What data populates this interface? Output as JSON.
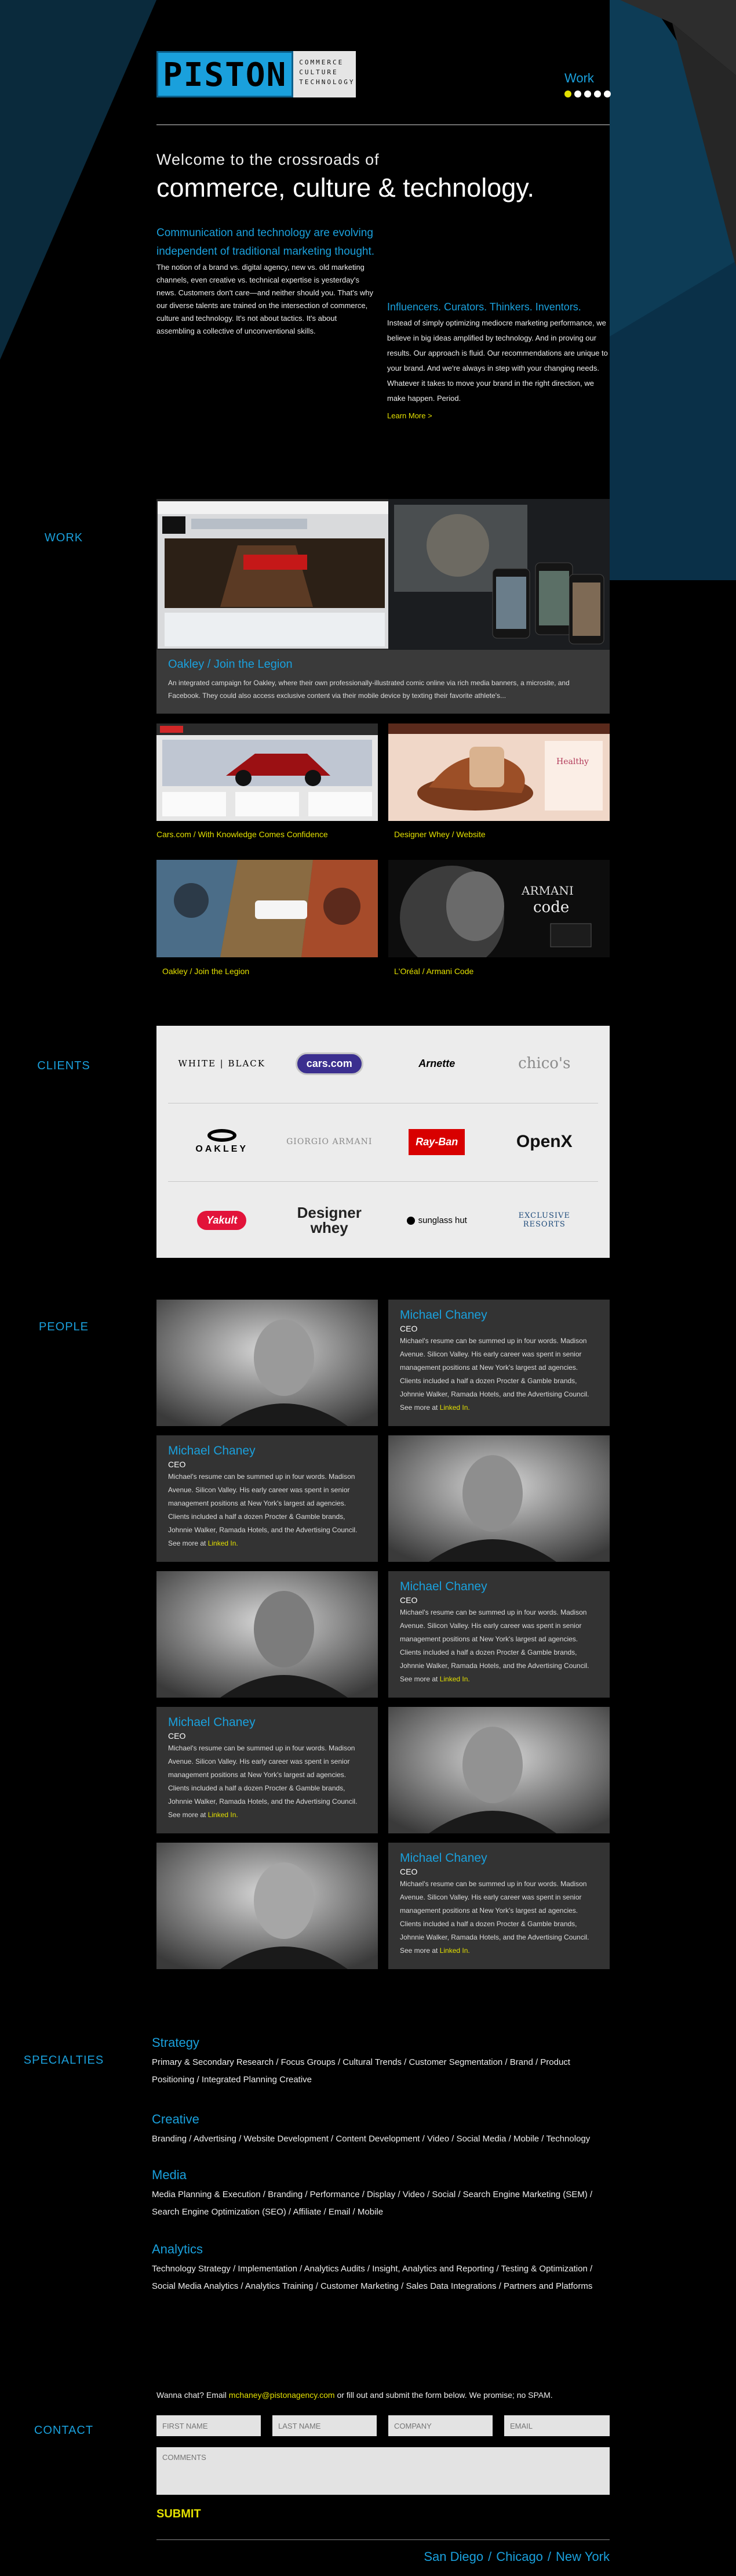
{
  "brand": {
    "logo_text": "PISTON",
    "logo_lines": [
      "COMMERCE",
      "CULTURE",
      "TECHNOLOGY"
    ]
  },
  "nav": {
    "work_label": "Work",
    "dots": 5,
    "active_dot": 0
  },
  "hero": {
    "welcome": "Welcome to the crossroads of",
    "tagline": "commerce, culture & technology."
  },
  "intro": {
    "left_lead": "Communication and technology are evolving independent of traditional marketing thought.",
    "left_body": "The notion of a brand vs. digital agency, new vs. old marketing channels, even creative vs. technical expertise is yesterday's news. Customers don't care—and neither should you. That's why our diverse talents are trained on the intersection of commerce, culture and technology. It's not about tactics. It's about assembling a collective of unconventional skills.",
    "right_lead": "Influencers. Curators. Thinkers. Inventors.",
    "right_body": "Instead of simply optimizing mediocre marketing performance, we believe in big ideas amplified by technology. And in proving our results. Our approach is fluid. Our recommendations are unique to your brand. And we're always in step with your changing needs. Whatever it takes to move your brand in the right direction, we make happen. Period.",
    "learn_more": "Learn More >"
  },
  "sections": {
    "work": "WORK",
    "clients": "CLIENTS",
    "people": "PEOPLE",
    "specialties": "SPECIALTIES",
    "contact": "CONTACT"
  },
  "work": {
    "featured_title": "Oakley / Join the Legion",
    "featured_desc": "An integrated campaign for Oakley, where their own professionally-illustrated comic online via rich media banners, a microsite, and Facebook. They could also access exclusive content via their mobile device by texting their favorite athlete's...",
    "items": [
      {
        "caption": "Cars.com / With Knowledge Comes Confidence"
      },
      {
        "caption": "Designer Whey / Website"
      },
      {
        "caption": "Oakley / Join the Legion"
      },
      {
        "caption": "L'Oréal / Armani Code"
      }
    ]
  },
  "clients": [
    [
      "WHITE | BLACK",
      "cars.com",
      "Arnette",
      "chico's"
    ],
    [
      "OAKLEY",
      "GIORGIO ARMANI",
      "Ray-Ban",
      "OpenX"
    ],
    [
      "Yakult",
      "Designer whey",
      "sunglass hut",
      "EXCLUSIVE RESORTS"
    ]
  ],
  "people": {
    "name": "Michael Chaney",
    "role": "CEO",
    "bio": "Michael's resume can be summed up in four words. Madison Avenue. Silicon Valley. His early career was spent in senior management positions at New York's largest ad agencies. Clients included a half a dozen Procter & Gamble brands, Johnnie Walker, Ramada Hotels, and the Advertising Council.",
    "see_more": "See more at",
    "link": "Linked In."
  },
  "specialties": [
    {
      "title": "Strategy",
      "items": "Primary & Secondary Research / Focus Groups / Cultural Trends / Customer Segmentation / Brand / Product Positioning / Integrated Planning Creative"
    },
    {
      "title": "Creative",
      "items": "Branding / Advertising / Website Development / Content Development / Video / Social Media / Mobile / Technology"
    },
    {
      "title": "Media",
      "items": "Media Planning & Execution / Branding / Performance / Display / Video / Social / Search Engine Marketing (SEM) / Search Engine Optimization (SEO) / Affiliate / Email / Mobile"
    },
    {
      "title": "Analytics",
      "items": "Technology Strategy / Implementation / Analytics Audits / Insight, Analytics and Reporting / Testing & Optimization / Social Media Analytics / Analytics Training / Customer Marketing / Sales Data Integrations / Partners and Platforms"
    }
  ],
  "contact": {
    "text_before": "Wanna chat? Email",
    "email": "mchaney@pistonagency.com",
    "text_after": "or fill out and submit the form below. We promise; no SPAM.",
    "first_name": "FIRST NAME",
    "last_name": "LAST NAME",
    "company": "COMPANY",
    "email_placeholder": "EMAIL",
    "comments": "COMMENTS",
    "submit": "SUBMIT"
  },
  "footer": {
    "cities": [
      "San Diego",
      "Chicago",
      "New York"
    ]
  },
  "colors": {
    "accent_blue": "#1aa0dc",
    "accent_yellow": "#e3e000",
    "background": "#000000"
  }
}
